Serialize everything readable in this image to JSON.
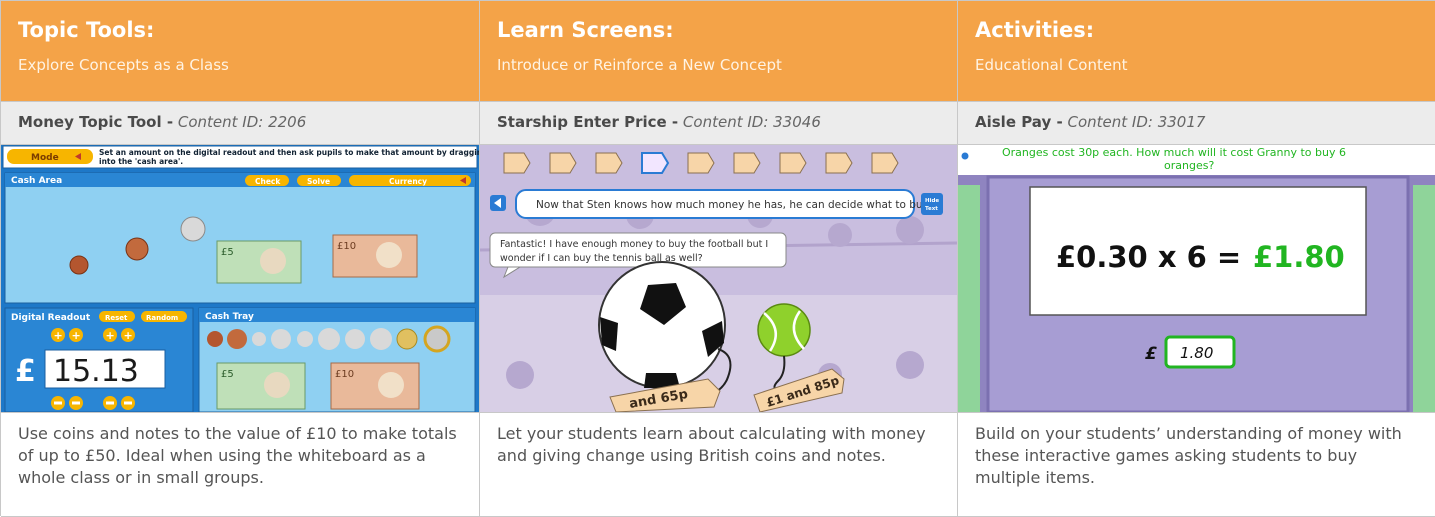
{
  "columns": [
    {
      "title": "Topic Tools:",
      "subtitle": "Explore Concepts as a Class",
      "resource_name": "Money Topic Tool -",
      "content_id": "Content ID: 2206",
      "description": "Use coins and notes to the value of £10 to make totals of up to £50. Ideal when using the whiteboard as a whole class or in small groups.",
      "screenshot": {
        "mode_label": "Mode",
        "instructions": "Set an amount on the digital readout and then ask pupils to make that amount by dragging the money into the 'cash area'.",
        "cash_area_label": "Cash Area",
        "check_label": "Check",
        "solve_label": "Solve",
        "currency_label": "Currency",
        "digital_readout_label": "Digital Readout",
        "reset_label": "Reset",
        "random_label": "Random",
        "cash_tray_label": "Cash Tray",
        "currency_symbol": "£",
        "readout_value": "15.13",
        "note5": "£5",
        "note10": "£10"
      }
    },
    {
      "title": "Learn Screens:",
      "subtitle": "Introduce or Reinforce a New Concept",
      "resource_name": "Starship Enter Price -",
      "content_id": "Content ID: 33046",
      "description": "Let your students learn about calculating with money and giving change using British coins and notes.",
      "screenshot": {
        "narration": "Now that Sten knows how much money he has, he can decide what to buy.",
        "hide_text_label": "Hide Text",
        "speech": "Fantastic! I have enough money to buy the football but I wonder if I can buy the tennis ball as well?",
        "tag_left": "and 65p",
        "tag_right": "£1 and 85p"
      }
    },
    {
      "title": "Activities:",
      "subtitle": "Educational Content",
      "resource_name": "Aisle Pay -",
      "content_id": "Content ID: 33017",
      "description": "Build on your students’ understanding of money with these interactive games asking students to buy multiple items.",
      "screenshot": {
        "question": "Oranges cost 30p each. How much will it cost Granny to buy 6 oranges?",
        "equation_left": "£0.30 x 6 =",
        "equation_answer": "£1.80",
        "answer_symbol": "£",
        "answer_value": "1.80"
      }
    }
  ],
  "colors": {
    "header": "#f4a348",
    "subheader": "#ececec",
    "answer_green": "#21b521",
    "tool_blue": "#1e78c8"
  }
}
